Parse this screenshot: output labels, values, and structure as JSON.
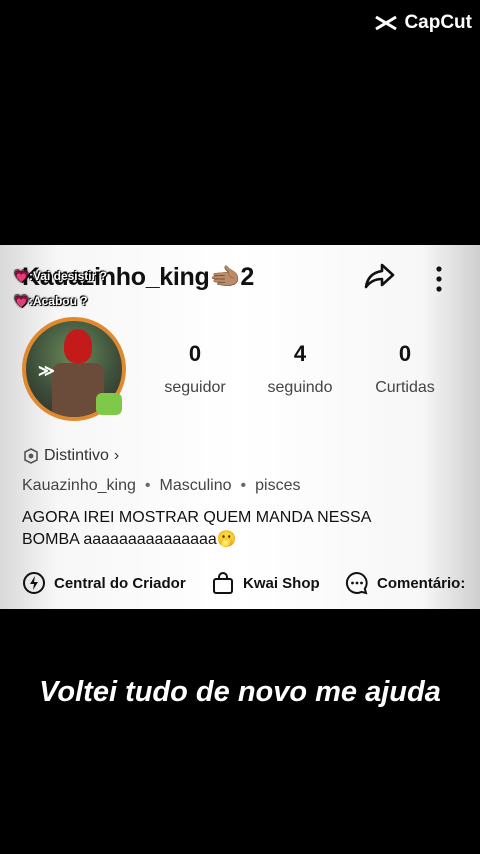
{
  "watermark": {
    "brand": "CapCut",
    "icon": "capcut-logo-icon"
  },
  "profile": {
    "username": "Kauazinho_king🫲🏽2",
    "avatar_icon": "avatar-image",
    "stickers": [
      "💗:Vai desistir ?",
      "💗:Acabou ?"
    ]
  },
  "stats": [
    {
      "value": "0",
      "label": "seguidor"
    },
    {
      "value": "4",
      "label": "seguindo"
    },
    {
      "value": "0",
      "label": "Curtidas"
    }
  ],
  "badge": {
    "label": "Distintivo",
    "chevron": "›"
  },
  "info": {
    "handle": "Kauazinho_king",
    "gender": "Masculino",
    "sign": "pisces",
    "separator": "•"
  },
  "bio": "AGORA IREI MOSTRAR QUEM MANDA NESSA BOMBA aaaaaaaaaaaaaaa🫢",
  "actions": [
    {
      "label": "Central do Criador",
      "icon": "creator-center-icon"
    },
    {
      "label": "Kwai Shop",
      "icon": "shopping-bag-icon"
    },
    {
      "label": "Comentário:",
      "icon": "comment-icon"
    }
  ],
  "caption": "Voltei tudo de novo me ajuda"
}
